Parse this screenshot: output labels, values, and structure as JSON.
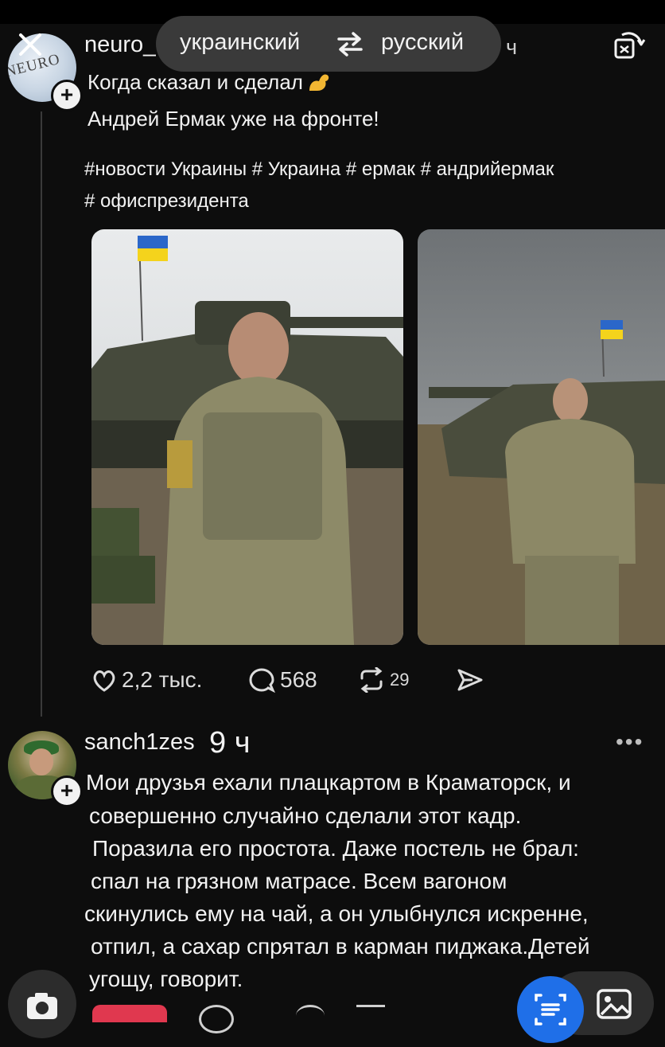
{
  "translation": {
    "source_language": "украинский",
    "target_language": "русский"
  },
  "post": {
    "author": "neuro_",
    "time_suffix": "ч",
    "avatar_text": "NEURO",
    "line1": "Когда сказал и сделал",
    "line2": "Андрей Ермак уже на фронте!",
    "hashtags_line1": "#новости Украины # Украина # ермак # андрийермак",
    "hashtags_line2": "# офиспрезидента",
    "likes": "2,2 тыс.",
    "replies": "568",
    "reposts": "29"
  },
  "comment": {
    "author": "sanch1zes",
    "time": "9 ч",
    "lines": [
      "Мои друзья ехали плацкартом в Краматорск, и",
      "совершенно случайно сделали этот кадр.",
      "Поразила его простота. Даже постель не брал:",
      "спал на грязном матрасе. Всем вагоном",
      "скинулись ему на чай, а он улыбнулся искренне,",
      "отпил, а сахар спрятал в карман пиджака.Детей",
      "угощу, говорит."
    ]
  },
  "icons": {
    "close": "close-icon",
    "swap": "swap-icon",
    "repost_top": "repost-icon",
    "like": "heart-icon",
    "reply": "reply-icon",
    "repost": "repost-icon",
    "share": "share-icon",
    "more": "more-icon",
    "camera": "camera-icon",
    "lens": "text-scan-icon",
    "gallery": "gallery-icon"
  },
  "colors": {
    "background": "#0d0d0d",
    "pill": "#3a3a3a",
    "lens_blue": "#1f6fe8",
    "like_red": "#e0384f"
  }
}
